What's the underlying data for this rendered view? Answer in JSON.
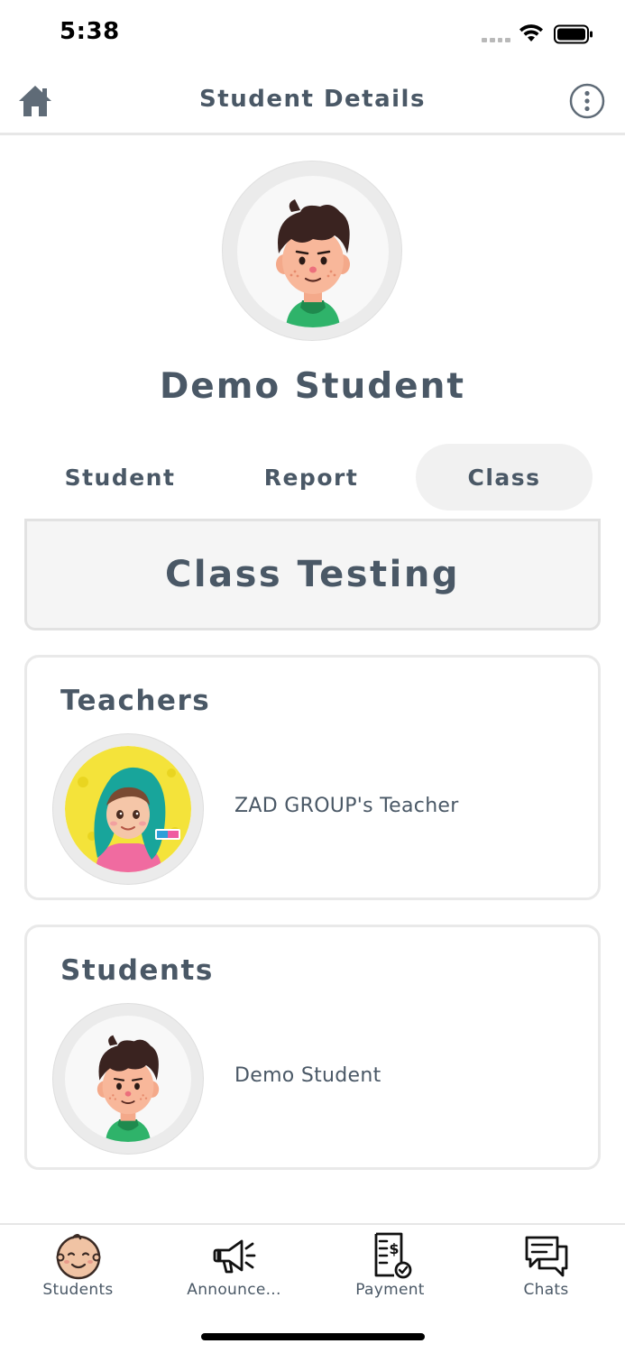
{
  "status_bar": {
    "time": "5:38"
  },
  "header": {
    "title": "Student Details",
    "home_icon": "home-icon",
    "more_icon": "more-vertical-icon"
  },
  "profile": {
    "name": "Demo Student",
    "avatar": "boy-avatar"
  },
  "tabs": [
    {
      "label": "Student",
      "active": false
    },
    {
      "label": "Report",
      "active": false
    },
    {
      "label": "Class",
      "active": true
    }
  ],
  "class_name": "Class Testing",
  "teachers": {
    "title": "Teachers",
    "items": [
      {
        "name": "ZAD GROUP's Teacher",
        "avatar": "hijab-girl-avatar"
      }
    ]
  },
  "students": {
    "title": "Students",
    "items": [
      {
        "name": "Demo Student",
        "avatar": "boy-avatar"
      }
    ]
  },
  "bottom_nav": [
    {
      "label": "Students",
      "icon": "baby-face-icon",
      "active": true
    },
    {
      "label": "Announce...",
      "icon": "megaphone-icon",
      "active": false
    },
    {
      "label": "Payment",
      "icon": "receipt-dollar-icon",
      "active": false
    },
    {
      "label": "Chats",
      "icon": "chat-bubbles-icon",
      "active": false
    }
  ],
  "colors": {
    "text": "#4a5866",
    "active_tab_bg": "#f1f1f1",
    "banner_bg": "#f5f5f5",
    "border": "#e9e9e9"
  }
}
